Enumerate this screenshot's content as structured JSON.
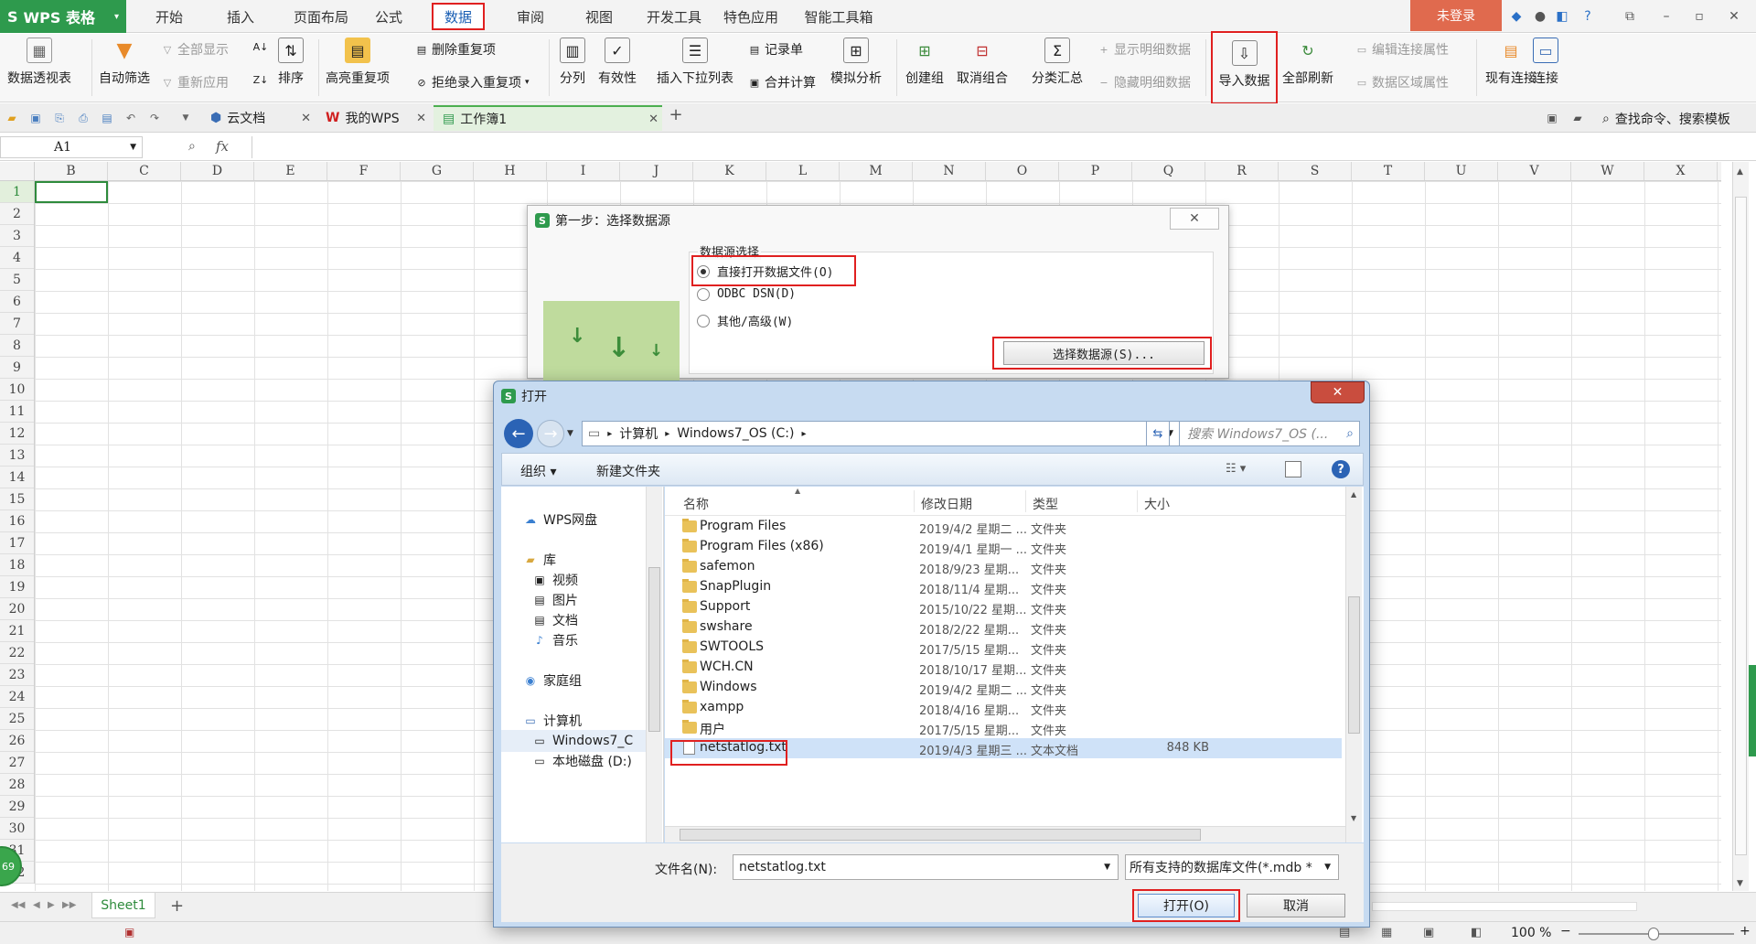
{
  "app": {
    "name": "WPS 表格"
  },
  "menu": {
    "tabs": [
      "开始",
      "插入",
      "页面布局",
      "公式",
      "数据",
      "审阅",
      "视图",
      "开发工具",
      "特色应用",
      "智能工具箱"
    ],
    "login": "未登录"
  },
  "ribbon": {
    "pivot": "数据透视表",
    "autofilter": "自动筛选",
    "show_all": "全部显示",
    "reapply": "重新应用",
    "sort": "排序",
    "highlight_dup": "高亮重复项",
    "delete_dup": "删除重复项",
    "reject_dup": "拒绝录入重复项",
    "split": "分列",
    "validity": "有效性",
    "insert_dropdown": "插入下拉列表",
    "record": "记录单",
    "merge_calc": "合并计算",
    "simulate": "模拟分析",
    "create_group": "创建组",
    "ungroup": "取消组合",
    "subtotal": "分类汇总",
    "show_detail": "显示明细数据",
    "hide_detail": "隐藏明细数据",
    "import_data": "导入数据",
    "refresh_all": "全部刷新",
    "edit_link": "编辑连接属性",
    "data_range": "数据区域属性",
    "existing_conn": "现有连接",
    "connect": "连接"
  },
  "doc_tabs": {
    "cloud": "云文档",
    "mywps": "我的WPS",
    "workbook": "工作簿1",
    "search_cmd": "查找命令、搜索模板"
  },
  "formula_bar": {
    "cell_ref": "A1",
    "fx": "fx"
  },
  "grid": {
    "columns": [
      "B",
      "C",
      "D",
      "E",
      "F",
      "G",
      "H",
      "I",
      "J",
      "K",
      "L",
      "M",
      "N",
      "O",
      "P",
      "Q",
      "R",
      "S",
      "T",
      "U",
      "V",
      "W",
      "X"
    ],
    "rows": [
      "1",
      "2",
      "3",
      "4",
      "5",
      "6",
      "7",
      "8",
      "9",
      "10",
      "11",
      "12",
      "13",
      "14",
      "15",
      "16",
      "17",
      "18",
      "19",
      "20",
      "21",
      "22",
      "23",
      "24",
      "25",
      "26",
      "27",
      "28",
      "29",
      "30",
      "31",
      "32"
    ],
    "badge": "69"
  },
  "sheets": {
    "tabs": [
      "Sheet1"
    ],
    "zoom": "100 %"
  },
  "wizard": {
    "title": "第一步：选择数据源",
    "group_label": "数据源选择",
    "options": [
      "直接打开数据文件(O)",
      "ODBC DSN(D)",
      "其他/高级(W)"
    ],
    "select_button": "选择数据源(S)..."
  },
  "open_dialog": {
    "title": "打开",
    "address": [
      "计算机",
      "Windows7_OS (C:)"
    ],
    "search_placeholder": "搜索 Windows7_OS (...",
    "toolbar": {
      "organize": "组织 ▾",
      "new_folder": "新建文件夹"
    },
    "nav": {
      "wps_disk": "WPS网盘",
      "library": "库",
      "video": "视频",
      "pictures": "图片",
      "documents": "文档",
      "music": "音乐",
      "homegroup": "家庭组",
      "computer": "计算机",
      "drive_c": "Windows7_C",
      "drive_d": "本地磁盘 (D:)"
    },
    "columns": {
      "name": "名称",
      "date": "修改日期",
      "type": "类型",
      "size": "大小"
    },
    "files": [
      {
        "name": "Program Files",
        "date": "2019/4/2 星期二 ...",
        "type": "文件夹",
        "size": ""
      },
      {
        "name": "Program Files (x86)",
        "date": "2019/4/1 星期一 ...",
        "type": "文件夹",
        "size": ""
      },
      {
        "name": "safemon",
        "date": "2018/9/23 星期...",
        "type": "文件夹",
        "size": ""
      },
      {
        "name": "SnapPlugin",
        "date": "2018/11/4 星期...",
        "type": "文件夹",
        "size": ""
      },
      {
        "name": "Support",
        "date": "2015/10/22 星期...",
        "type": "文件夹",
        "size": ""
      },
      {
        "name": "swshare",
        "date": "2018/2/22 星期...",
        "type": "文件夹",
        "size": ""
      },
      {
        "name": "SWTOOLS",
        "date": "2017/5/15 星期...",
        "type": "文件夹",
        "size": ""
      },
      {
        "name": "WCH.CN",
        "date": "2018/10/17 星期...",
        "type": "文件夹",
        "size": ""
      },
      {
        "name": "Windows",
        "date": "2019/4/2 星期二 ...",
        "type": "文件夹",
        "size": ""
      },
      {
        "name": "xampp",
        "date": "2018/4/16 星期...",
        "type": "文件夹",
        "size": ""
      },
      {
        "name": "用户",
        "date": "2017/5/15 星期...",
        "type": "文件夹",
        "size": ""
      },
      {
        "name": "netstatlog.txt",
        "date": "2019/4/3 星期三 ...",
        "type": "文本文档",
        "size": "848 KB"
      }
    ],
    "filename_label": "文件名(N):",
    "filename_value": "netstatlog.txt",
    "filetype": "所有支持的数据库文件(*.mdb *",
    "open_button": "打开(O)",
    "cancel_button": "取消"
  },
  "colors": {
    "wps_green": "#2e9a4d",
    "highlight_red": "#e02020",
    "login_orange": "#e06a4e"
  }
}
